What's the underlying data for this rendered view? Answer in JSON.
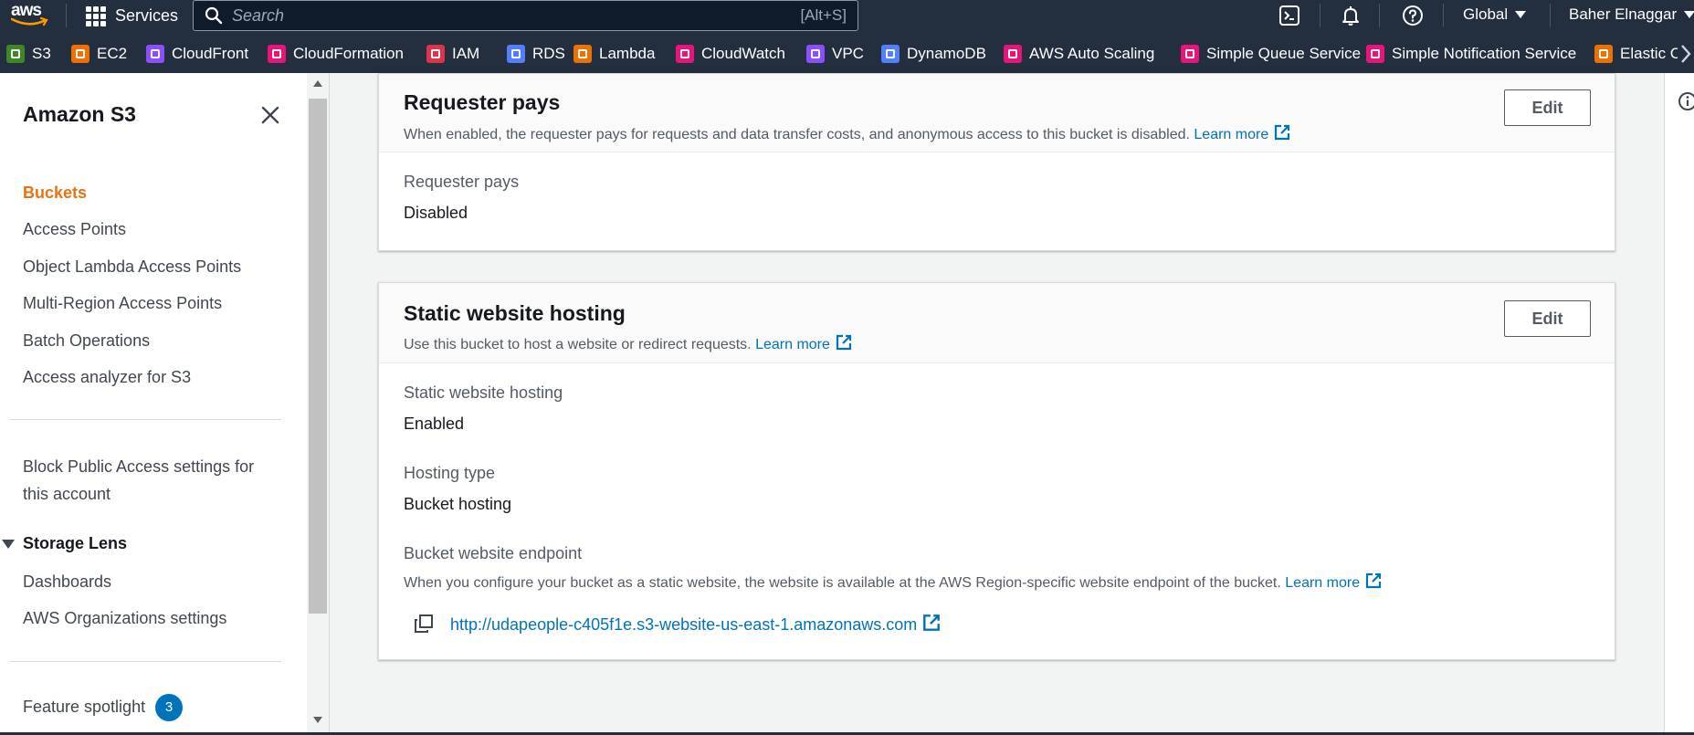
{
  "topnav": {
    "logo_text": "aws",
    "services_label": "Services",
    "search_placeholder": "Search",
    "search_shortcut": "[Alt+S]",
    "region": "Global",
    "account": "Baher Elnaggar"
  },
  "favorites": [
    {
      "label": "S3",
      "color": "#3f8624",
      "icon": "s3-icon"
    },
    {
      "label": "EC2",
      "color": "#ed7100",
      "icon": "ec2-icon"
    },
    {
      "label": "CloudFront",
      "color": "#8c4fff",
      "icon": "cloudfront-icon"
    },
    {
      "label": "CloudFormation",
      "color": "#e7157b",
      "icon": "cloudformation-icon"
    },
    {
      "label": "IAM",
      "color": "#dd344c",
      "icon": "iam-icon"
    },
    {
      "label": "RDS",
      "color": "#527fff",
      "icon": "rds-icon"
    },
    {
      "label": "Lambda",
      "color": "#ed7100",
      "icon": "lambda-icon"
    },
    {
      "label": "CloudWatch",
      "color": "#e7157b",
      "icon": "cloudwatch-icon"
    },
    {
      "label": "VPC",
      "color": "#8c4fff",
      "icon": "vpc-icon"
    },
    {
      "label": "DynamoDB",
      "color": "#527fff",
      "icon": "dynamodb-icon"
    },
    {
      "label": "AWS Auto Scaling",
      "color": "#e7157b",
      "icon": "autoscaling-icon"
    },
    {
      "label": "Simple Queue Service",
      "color": "#e7157b",
      "icon": "sqs-icon"
    },
    {
      "label": "Simple Notification Service",
      "color": "#e7157b",
      "icon": "sns-icon"
    },
    {
      "label": "Elastic C",
      "color": "#ed7100",
      "icon": "elastic-icon"
    }
  ],
  "sidenav": {
    "title": "Amazon S3",
    "links": [
      {
        "label": "Buckets",
        "active": true
      },
      {
        "label": "Access Points"
      },
      {
        "label": "Object Lambda Access Points"
      },
      {
        "label": "Multi-Region Access Points"
      },
      {
        "label": "Batch Operations"
      },
      {
        "label": "Access analyzer for S3"
      }
    ],
    "block_public_access": "Block Public Access settings for this account",
    "storage_lens": {
      "label": "Storage Lens",
      "items": [
        "Dashboards",
        "AWS Organizations settings"
      ]
    },
    "feature_spotlight": {
      "label": "Feature spotlight",
      "count": "3"
    }
  },
  "requester_pays": {
    "title": "Requester pays",
    "description": "When enabled, the requester pays for requests and data transfer costs, and anonymous access to this bucket is disabled.",
    "learn_more": "Learn more",
    "edit_label": "Edit",
    "field_label": "Requester pays",
    "field_value": "Disabled"
  },
  "static_hosting": {
    "title": "Static website hosting",
    "description": "Use this bucket to host a website or redirect requests.",
    "learn_more": "Learn more",
    "edit_label": "Edit",
    "status_label": "Static website hosting",
    "status_value": "Enabled",
    "type_label": "Hosting type",
    "type_value": "Bucket hosting",
    "endpoint_label": "Bucket website endpoint",
    "endpoint_desc": "When you configure your bucket as a static website, the website is available at the AWS Region-specific website endpoint of the bucket.",
    "endpoint_learn_more": "Learn more",
    "endpoint_url": "http://udapeople-c405f1e.s3-website-us-east-1.amazonaws.com"
  },
  "colors": {
    "nav_bg": "#232f3e",
    "active_link": "#ec7211",
    "link": "#0073bb"
  }
}
